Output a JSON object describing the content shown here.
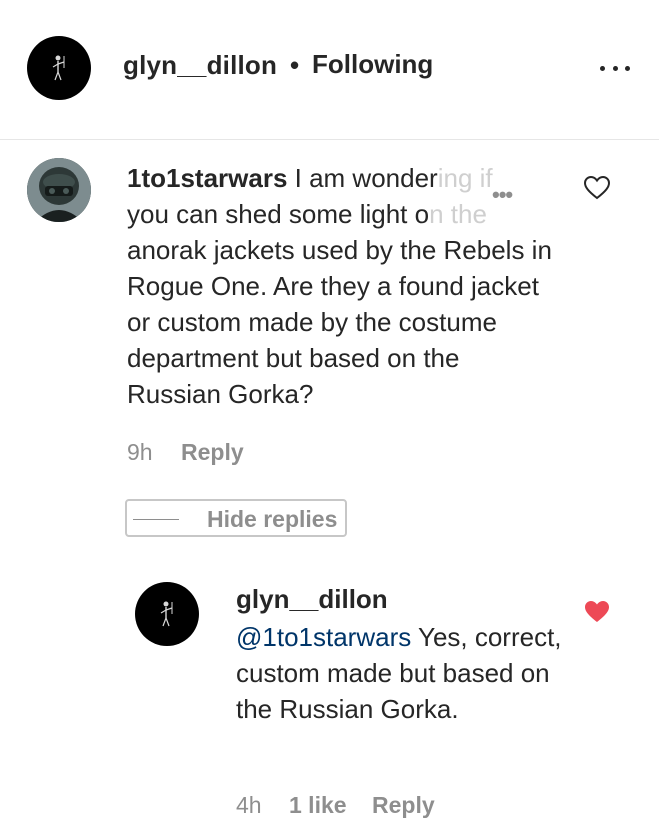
{
  "header": {
    "username": "glyn__dillon",
    "separator": "•",
    "follow_status": "Following"
  },
  "comment": {
    "username": "1to1starwars",
    "text_start": " I am wonder",
    "text_faded_1": "ing if",
    "line2_start": "you can shed some light o",
    "text_faded_2": "n the",
    "text_rest": "anorak jackets used by the Rebels in Rogue One. Are they a found jacket or custom made by the costume department but based on the Russian Gorka?",
    "time": "9h",
    "reply_label": "Reply",
    "hide_replies_label": "Hide replies"
  },
  "reply": {
    "username": "glyn__dillon",
    "mention": "@1to1starwars",
    "text": " Yes, correct, custom made but based on the Russian Gorka.",
    "time": "4h",
    "likes": "1 like",
    "reply_label": "Reply"
  },
  "colors": {
    "liked_heart": "#ed4956",
    "mention": "#003569",
    "muted": "#8e8e8e"
  }
}
